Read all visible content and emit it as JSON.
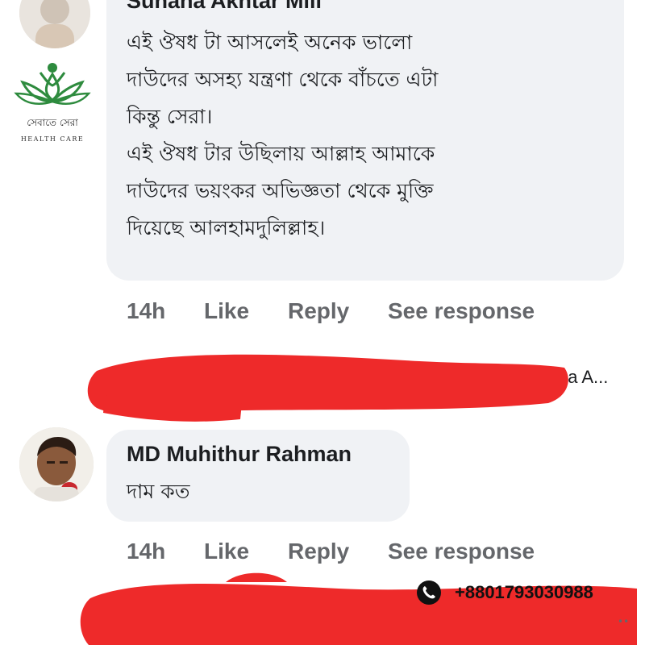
{
  "comments": [
    {
      "author": "Suhana Akhtar Mili",
      "text": "এই ঔষধ টা আসলেই অনেক ভালো\nদাউদের অসহ্য যন্ত্রণা থেকে বাঁচতে এটা\nকিন্তু সেরা।\nএই ঔষধ টার উছিলায় আল্লাহ  আমাকে\nদাউদের ভয়ংকর অভিজ্ঞতা থেকে মুক্তি\nদিয়েছে আলহামদুলিল্লাহ।",
      "time": "14h",
      "like_label": "Like",
      "reply_label": "Reply",
      "see_response_label": "See response"
    },
    {
      "author": "MD Muhithur Rahman",
      "text": "দাম কত",
      "time": "14h",
      "like_label": "Like",
      "reply_label": "Reply",
      "see_response_label": "See response"
    }
  ],
  "redacted_reply_tail": "na A...",
  "logo": {
    "bengali_name": "সেবাতে সেরা",
    "subtitle": "HEALTH CARE",
    "icon": "lotus-person-icon",
    "color": "#2e8b3e"
  },
  "phone": {
    "icon": "phone-icon",
    "number": "+8801793030988"
  },
  "colors": {
    "bubble": "#f0f2f5",
    "action_text": "#65676b",
    "redaction": "#ee2a2a"
  }
}
